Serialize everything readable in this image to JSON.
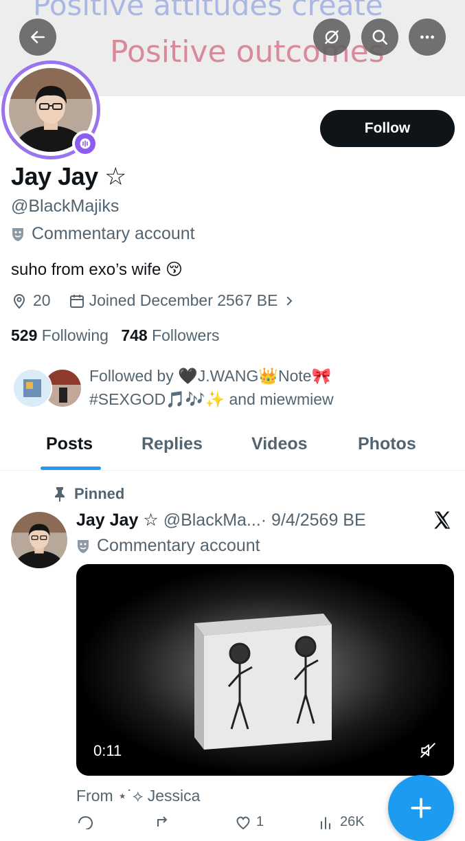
{
  "banner": {
    "line1": "Positive attitudes create",
    "line2": "Positive outcomes"
  },
  "header_buttons": {
    "back": "back-arrow-icon",
    "grok": "grok-icon",
    "search": "search-icon",
    "more": "more-icon"
  },
  "profile": {
    "follow_label": "Follow",
    "name": "Jay Jay",
    "name_suffix": "☆",
    "handle": "@BlackMajiks",
    "label": "Commentary account",
    "bio": "suho from exo’s wife 😚",
    "location": "20",
    "joined": "Joined December 2567 BE",
    "following_count": "529",
    "following_label": "Following",
    "followers_count": "748",
    "followers_label": "Followers",
    "followed_by_line1": "Followed by 🖤J.WANG👑Note🎀",
    "followed_by_line2": "#SEXGOD🎵🎶✨ and miewmiew"
  },
  "tabs": [
    "Posts",
    "Replies",
    "Videos",
    "Photos"
  ],
  "active_tab": "Posts",
  "post": {
    "pinned_label": "Pinned",
    "author_name": "Jay Jay ☆",
    "author_handle": "@BlackMa...",
    "date": "· 9/4/2569 BE",
    "author_label": "Commentary account",
    "video_duration": "0:11",
    "from_text": "From ⋆˙⟡ Jessica",
    "stats": {
      "replies": "",
      "reposts": "",
      "likes": "1",
      "views": "26K"
    }
  },
  "colors": {
    "accent": "#1d9bf0",
    "text": "#0f1419",
    "muted": "#536471",
    "spaces_ring": "#9a73ef"
  }
}
